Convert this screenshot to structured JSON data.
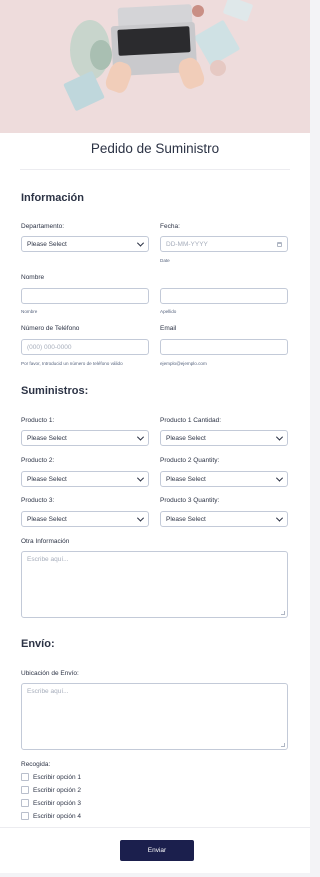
{
  "form": {
    "title": "Pedido de Suministro",
    "submit_label": "Enviar"
  },
  "info": {
    "heading": "Información",
    "departamento_label": "Departamento:",
    "departamento_value": "Please Select",
    "fecha_label": "Fecha:",
    "fecha_placeholder": "DD-MM-YYYY",
    "fecha_sublabel": "Date",
    "nombre_label": "Nombre",
    "nombre_sublabel": "Nombre",
    "apellido_sublabel": "Apellido",
    "telefono_label": "Número de Teléfono",
    "telefono_placeholder": "(000) 000-0000",
    "telefono_sublabel": "Por favor, Introducid un número de teléfono válido",
    "email_label": "Email",
    "email_sublabel": "ejemplo@ejemplo.com"
  },
  "supplies": {
    "heading": "Suministros:",
    "producto1_label": "Producto 1:",
    "producto1_qty_label": "Producto 1 Cantidad:",
    "producto2_label": "Producto 2:",
    "producto2_qty_label": "Producto 2 Quantity:",
    "producto3_label": "Producto 3:",
    "producto3_qty_label": "Producto 3 Quantity:",
    "select_value": "Please Select",
    "otra_label": "Otra Información",
    "textarea_placeholder": "Escribe aquí..."
  },
  "shipping": {
    "heading": "Envío:",
    "ubicacion_label": "Ubicación de Envío:",
    "textarea_placeholder": "Escribe aquí...",
    "recogida_label": "Recogida:",
    "options": [
      "Escribir opción 1",
      "Escribir opción 2",
      "Escribir opción 3",
      "Escribir opción 4"
    ]
  },
  "icons": [
    "chevron-down-icon",
    "calendar-icon",
    "resize-grip-icon"
  ],
  "colors": {
    "submit_bg": "#1b1f4d",
    "text": "#2c3345",
    "border": "#c3cad8",
    "hero_bg": "#eedcdc"
  }
}
